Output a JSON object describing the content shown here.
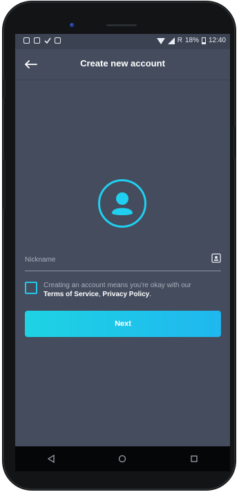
{
  "colors": {
    "screen_bg": "#444c5d",
    "accent": "#20d0f0"
  },
  "statusbar": {
    "battery": "18%",
    "time": "12:40"
  },
  "appbar": {
    "title": "Create new account"
  },
  "form": {
    "nickname_placeholder": "Nickname",
    "terms_text": "Creating an account means you're okay with our",
    "terms_link": "Terms of Service",
    "terms_sep": ", ",
    "privacy_link": "Privacy Policy",
    "terms_end": "."
  },
  "actions": {
    "next_label": "Next"
  }
}
